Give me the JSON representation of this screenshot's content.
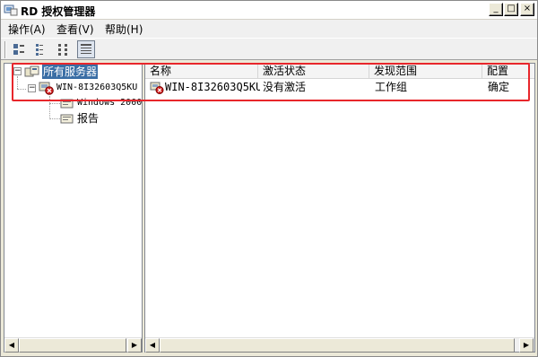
{
  "window": {
    "title": "RD 授权管理器",
    "min_glyph": "_",
    "max_glyph": "□",
    "close_glyph": "×"
  },
  "menu": {
    "items": [
      "操作(A)",
      "查看(V)",
      "帮助(H)"
    ]
  },
  "toolbar": {
    "buttons": [
      "large-icons-view",
      "small-icons-view",
      "list-view",
      "details-view"
    ],
    "active": "details-view"
  },
  "tree": {
    "root_label": "所有服务器",
    "server_label": "WIN-8I32603Q5KU",
    "child_1_label": "Windows 2000",
    "child_2_label": "报告",
    "expander_minus": "−"
  },
  "list": {
    "columns": [
      "名称",
      "激活状态",
      "发现范围",
      "配置"
    ],
    "rows": [
      {
        "name": "WIN-8I32603Q5KU",
        "status": "没有激活",
        "scope": "工作组",
        "config": "确定"
      }
    ]
  },
  "scroll": {
    "left_arrow": "◀",
    "right_arrow": "▶"
  },
  "colors": {
    "highlight": "#e8262b",
    "selection": "#3a6ea5",
    "error_badge": "#d42020"
  }
}
